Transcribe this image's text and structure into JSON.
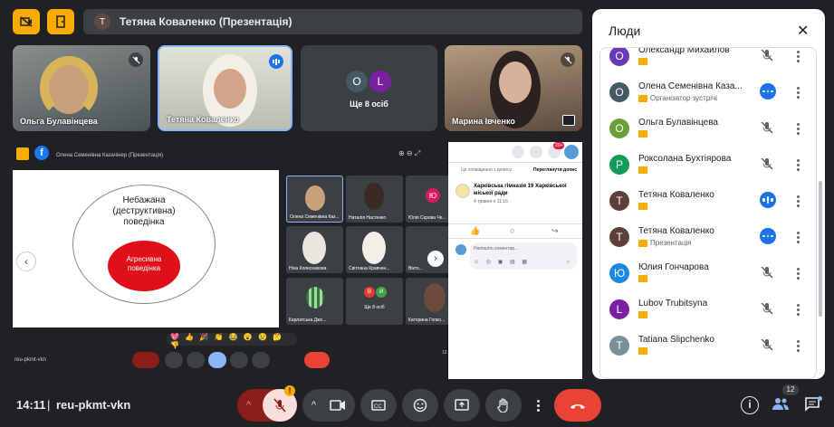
{
  "colors": {
    "accent": "#f9ab00",
    "end_call": "#ea4335",
    "blue": "#1a73e8",
    "bg": "#202124"
  },
  "top_bar": {
    "presenter_initial": "T",
    "presenter_label": "Тетяна Коваленко (Презентація)"
  },
  "tiles": [
    {
      "name": "Ольга Булавінцева"
    },
    {
      "name": "Тетяна Коваленко"
    },
    {
      "name": "Ще 8 осіб",
      "initials": [
        "O",
        "L"
      ]
    },
    {
      "name": "Марина Івченко"
    }
  ],
  "shared_screen": {
    "title": "Олена Семенівна Казачінер (Презентація)",
    "slide_outer": "Небажана (деструктивна) поведінка",
    "slide_inner": "Агресивна поведінка",
    "grid": [
      {
        "name": "Олена Семенівна Каз..."
      },
      {
        "name": "Наталія Настенко"
      },
      {
        "name": "Юлія Сєрова Че...",
        "initial": "Ю"
      },
      {
        "name": "Ніна Колесникова"
      },
      {
        "name": "Світлана Кравчен..."
      },
      {
        "name": "Вікто..."
      },
      {
        "name": "Карлатська Джо..."
      },
      {
        "name": "Ще 8 осіб",
        "initials": [
          "В",
          "И"
        ]
      },
      {
        "name": "Катерина Гопко..."
      }
    ],
    "inner_meeting_code": "reu-pkmt-vkn",
    "inner_badge": "12",
    "fb": {
      "notice": "Це сповіщення з допису.",
      "view_post": "Переглянути допис",
      "page": "Харківська гімназія 19 Харківської міської ради",
      "date": "4 травня о 11:16 ·",
      "comment_placeholder": "Напишіть коментар...",
      "notif_count": "20+"
    }
  },
  "bottom": {
    "time": "14:11",
    "separator": "|",
    "meeting_code": "reu-pkmt-vkn",
    "people_count": "12",
    "alert": "!"
  },
  "panel": {
    "title": "Люди",
    "people": [
      {
        "initial": "O",
        "name": "Олександр Михайлов",
        "color": "#673ab7",
        "sub": "",
        "state": "muted"
      },
      {
        "initial": "O",
        "name": "Олена Семенівна Каза...",
        "color": "#455a64",
        "sub": "Організатор зустрічі",
        "state": "speaking"
      },
      {
        "initial": "O",
        "name": "Ольга Булавінцева",
        "color": "#689f38",
        "sub": "",
        "state": "muted"
      },
      {
        "initial": "P",
        "name": "Роксолана Бухтіярова",
        "color": "#0f9d58",
        "sub": "",
        "state": "muted"
      },
      {
        "initial": "T",
        "name": "Тетяна Коваленко",
        "color": "#5d4037",
        "sub": "",
        "state": "audio"
      },
      {
        "initial": "T",
        "name": "Тетяна Коваленко",
        "color": "#5d4037",
        "sub": "Презентація",
        "state": "speaking"
      },
      {
        "initial": "Ю",
        "name": "Юлия Гончарова",
        "color": "#1e88e5",
        "sub": "",
        "state": "muted"
      },
      {
        "initial": "L",
        "name": "Lubov Trubitsyna",
        "color": "#7b1fa2",
        "sub": "",
        "state": "muted"
      },
      {
        "initial": "T",
        "name": "Tatiana Slipchenko",
        "color": "#78909c",
        "sub": "",
        "state": "muted"
      }
    ]
  }
}
